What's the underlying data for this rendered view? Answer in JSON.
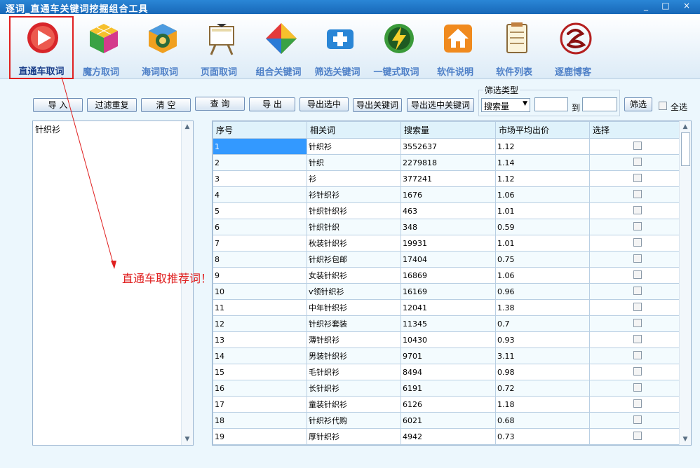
{
  "window": {
    "title": "逐词_直通车关键词挖掘组合工具",
    "min": "_",
    "max": "□",
    "close": "×"
  },
  "toolbar": [
    {
      "label": "直通车取词",
      "icon": "play-button-icon"
    },
    {
      "label": "魔方取词",
      "icon": "rubiks-cube-icon"
    },
    {
      "label": "海词取词",
      "icon": "ring-cube-icon"
    },
    {
      "label": "页面取词",
      "icon": "easel-icon"
    },
    {
      "label": "组合关键词",
      "icon": "diamond-icon"
    },
    {
      "label": "筛选关键词",
      "icon": "medical-cross-icon"
    },
    {
      "label": "一键式取词",
      "icon": "lightning-icon"
    },
    {
      "label": "软件说明",
      "icon": "home-icon"
    },
    {
      "label": "软件列表",
      "icon": "notepad-icon"
    },
    {
      "label": "逐鹿博客",
      "icon": "calligraphy-logo-icon"
    }
  ],
  "actions": {
    "import": "导 入",
    "dedupe": "过滤重复",
    "clear": "清 空",
    "query": "查 询",
    "export": "导 出",
    "export_selected": "导出选中",
    "export_keywords": "导出关键词",
    "export_selected_keywords": "导出选中关键词"
  },
  "filter": {
    "group_label": "筛选类型",
    "type_value": "搜索量",
    "to_label": "到",
    "button": "筛选",
    "select_all": "全选"
  },
  "left_list": {
    "text": "针织衫"
  },
  "annotation": "直通车取推荐词！",
  "table": {
    "headers": [
      "序号",
      "相关词",
      "搜索量",
      "市场平均出价",
      "选择"
    ],
    "rows": [
      [
        "1",
        "针织衫",
        "3552637",
        "1.12"
      ],
      [
        "2",
        "针织",
        "2279818",
        "1.14"
      ],
      [
        "3",
        "衫",
        "377241",
        "1.12"
      ],
      [
        "4",
        "衫针织衫",
        "1676",
        "1.06"
      ],
      [
        "5",
        "针织针织衫",
        "463",
        "1.01"
      ],
      [
        "6",
        "针织针织",
        "348",
        "0.59"
      ],
      [
        "7",
        "秋装针织衫",
        "19931",
        "1.01"
      ],
      [
        "8",
        "针织衫包邮",
        "17404",
        "0.75"
      ],
      [
        "9",
        "女装针织衫",
        "16869",
        "1.06"
      ],
      [
        "10",
        "v领针织衫",
        "16169",
        "0.96"
      ],
      [
        "11",
        "中年针织衫",
        "12041",
        "1.38"
      ],
      [
        "12",
        "针织衫套装",
        "11345",
        "0.7"
      ],
      [
        "13",
        "薄针织衫",
        "10430",
        "0.93"
      ],
      [
        "14",
        "男装针织衫",
        "9701",
        "3.11"
      ],
      [
        "15",
        "毛针织衫",
        "8494",
        "0.98"
      ],
      [
        "16",
        "长针织衫",
        "6191",
        "0.72"
      ],
      [
        "17",
        "童装针织衫",
        "6126",
        "1.18"
      ],
      [
        "18",
        "针织衫代购",
        "6021",
        "0.68"
      ],
      [
        "19",
        "厚针织衫",
        "4942",
        "0.73"
      ]
    ]
  }
}
